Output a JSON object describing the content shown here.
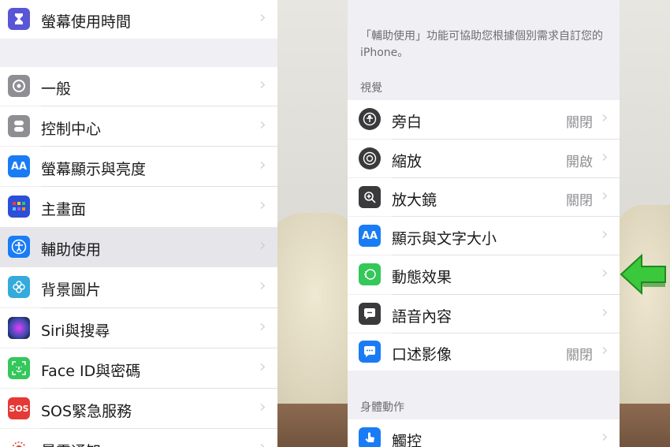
{
  "left_panel": {
    "items": [
      {
        "label": "螢幕使用時間",
        "icon": "hourglass-icon",
        "color": "#5856d6"
      },
      {
        "label": "一般",
        "icon": "gear-icon",
        "color": "#8e8e93"
      },
      {
        "label": "控制中心",
        "icon": "toggles-icon",
        "color": "#8e8e93"
      },
      {
        "label": "螢幕顯示與亮度",
        "icon": "text-size-icon",
        "color": "#1a7cf5"
      },
      {
        "label": "主畫面",
        "icon": "home-grid-icon",
        "color": "#2b4fd8"
      },
      {
        "label": "輔助使用",
        "icon": "accessibility-icon",
        "color": "#1a7cf5",
        "selected": true
      },
      {
        "label": "背景圖片",
        "icon": "flower-icon",
        "color": "#35aadc"
      },
      {
        "label": "Siri與搜尋",
        "icon": "siri-icon",
        "color": "#222"
      },
      {
        "label": "Face ID與密碼",
        "icon": "face-id-icon",
        "color": "#34c759"
      },
      {
        "label": "SOS緊急服務",
        "icon": "sos-icon",
        "color": "#e53935",
        "icon_text": "SOS"
      },
      {
        "label": "暴露通知",
        "icon": "exposure-icon",
        "color": "#e53935"
      }
    ]
  },
  "right_panel": {
    "description": "「輔助使用」功能可協助您根據個別需求自訂您的 iPhone。",
    "section_vision": "視覺",
    "vision_items": [
      {
        "label": "旁白",
        "value": "關閉",
        "icon": "voiceover-icon",
        "color": "#3a3a3c"
      },
      {
        "label": "縮放",
        "value": "開啟",
        "icon": "zoom-icon",
        "color": "#3a3a3c"
      },
      {
        "label": "放大鏡",
        "value": "關閉",
        "icon": "magnifier-icon",
        "color": "#3a3a3c"
      },
      {
        "label": "顯示與文字大小",
        "value": "",
        "icon": "text-size-icon",
        "color": "#1a7cf5"
      },
      {
        "label": "動態效果",
        "value": "",
        "icon": "motion-icon",
        "color": "#34c759"
      },
      {
        "label": "語音內容",
        "value": "",
        "icon": "speech-icon",
        "color": "#3a3a3c"
      },
      {
        "label": "口述影像",
        "value": "關閉",
        "icon": "audio-description-icon",
        "color": "#1a7cf5"
      }
    ],
    "section_physical": "身體動作",
    "physical_items": [
      {
        "label": "觸控",
        "value": "",
        "icon": "touch-icon",
        "color": "#1a7cf5"
      }
    ]
  },
  "annotation": {
    "icon": "green-arrow-icon",
    "color": "#3cc83c"
  }
}
